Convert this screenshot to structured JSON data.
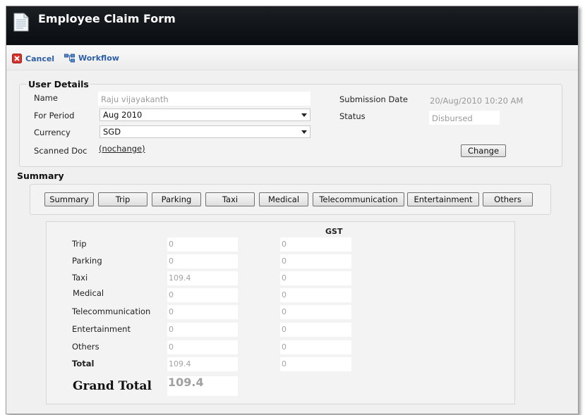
{
  "window": {
    "title": "Employee Claim Form"
  },
  "toolbar": {
    "cancel_label": "Cancel",
    "workflow_label": "Workflow"
  },
  "user_details": {
    "legend": "User Details",
    "name_label": "Name",
    "name_value": "Raju vijayakanth",
    "period_label": "For Period",
    "period_value": "Aug 2010",
    "currency_label": "Currency",
    "currency_value": "SGD",
    "scanned_label": "Scanned Doc",
    "scanned_value": "(nochange)",
    "submission_label": "Submission Date",
    "submission_value": "20/Aug/2010 10:20 AM",
    "status_label": "Status",
    "status_value": "Disbursed",
    "change_label": "Change"
  },
  "summary": {
    "heading": "Summary",
    "tabs": [
      "Summary",
      "Trip",
      "Parking",
      "Taxi",
      "Medical",
      "Telecommunication",
      "Entertainment",
      "Others"
    ],
    "gst_header": "GST",
    "rows": [
      {
        "label": "Trip",
        "amount": "0",
        "gst": "0"
      },
      {
        "label": "Parking",
        "amount": "0",
        "gst": "0"
      },
      {
        "label": "Taxi",
        "amount": "109.4",
        "gst": "0"
      },
      {
        "label": "Medical",
        "amount": "0",
        "gst": "0"
      },
      {
        "label": "Telecommunication",
        "amount": "0",
        "gst": "0"
      },
      {
        "label": "Entertainment",
        "amount": "0",
        "gst": "0"
      },
      {
        "label": "Others",
        "amount": "0",
        "gst": "0"
      },
      {
        "label": "Total",
        "amount": "109.4",
        "gst": "0"
      }
    ],
    "grand_total_label": "Grand Total",
    "grand_total_value": "109.4"
  }
}
